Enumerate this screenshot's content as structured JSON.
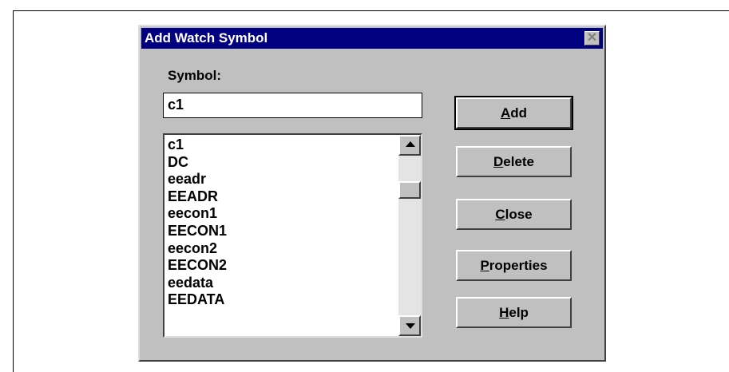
{
  "dialog": {
    "title": "Add Watch Symbol",
    "close_glyph": "✕"
  },
  "symbol": {
    "label": "Symbol:",
    "value": "c1"
  },
  "list": {
    "items": [
      "c1",
      "DC",
      "eeadr",
      "EEADR",
      "eecon1",
      "EECON1",
      "eecon2",
      "EECON2",
      "eedata",
      "EEDATA"
    ]
  },
  "buttons": {
    "add": {
      "mnemonic": "A",
      "rest": "dd"
    },
    "delete": {
      "mnemonic": "D",
      "rest": "elete"
    },
    "close": {
      "mnemonic": "C",
      "rest": "lose"
    },
    "properties": {
      "mnemonic": "P",
      "rest": "roperties"
    },
    "help": {
      "mnemonic": "H",
      "rest": "elp"
    }
  },
  "icons": {
    "scroll_up": "scroll-up-arrow-icon",
    "scroll_down": "scroll-down-arrow-icon",
    "close": "close-icon"
  },
  "colors": {
    "titlebar": "#000080",
    "dialog_bg": "#c0c0c0"
  }
}
